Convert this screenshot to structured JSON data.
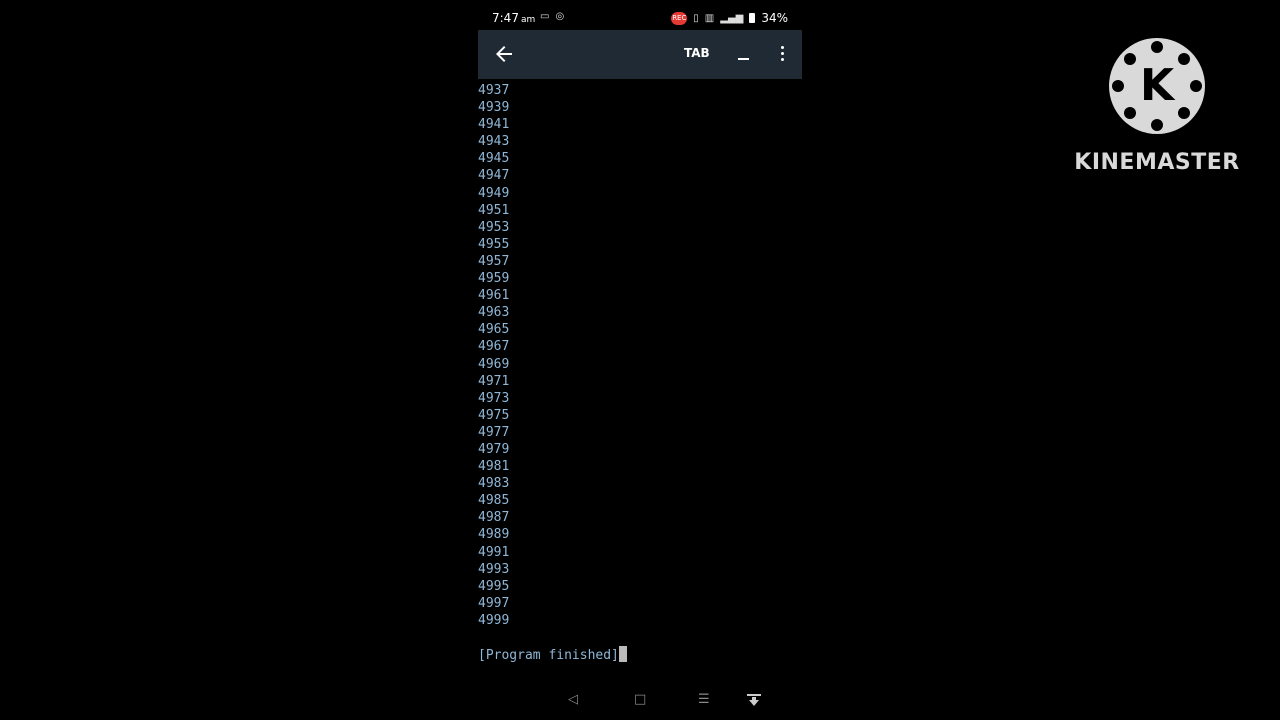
{
  "status_bar": {
    "time": "7:47",
    "ampm": "am",
    "left_icons": [
      "screen-record-icon",
      "hotspot-icon"
    ],
    "right_icons": [
      "rec-badge-icon",
      "vibrate-icon",
      "volte-icon",
      "signal-icon",
      "battery-icon"
    ],
    "rec_label": "REC",
    "battery": "34%"
  },
  "app_bar": {
    "tab_label": "TAB",
    "minimize_label": "_"
  },
  "terminal": {
    "lines": [
      "4937",
      "4939",
      "4941",
      "4943",
      "4945",
      "4947",
      "4949",
      "4951",
      "4953",
      "4955",
      "4957",
      "4959",
      "4961",
      "4963",
      "4965",
      "4967",
      "4969",
      "4971",
      "4973",
      "4975",
      "4977",
      "4979",
      "4981",
      "4983",
      "4985",
      "4987",
      "4989",
      "4991",
      "4993",
      "4995",
      "4997",
      "4999"
    ],
    "finished": "[Program finished]"
  },
  "nav_bar": {
    "icons": [
      "back-triangle-icon",
      "home-square-icon",
      "recents-icon",
      "keyboard-hide-icon"
    ]
  },
  "watermark": {
    "logo_letter": "K",
    "text": "KINEMASTER"
  }
}
